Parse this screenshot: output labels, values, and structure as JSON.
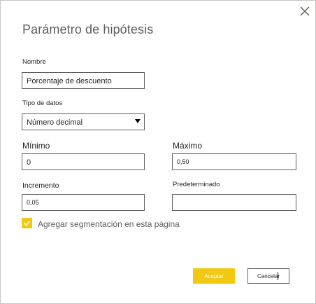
{
  "dialog": {
    "title": "Parámetro de hipótesis",
    "close_icon": "close-icon"
  },
  "fields": {
    "name_label": "Nombre",
    "name_value": "Porcentaje de descuento",
    "datatype_label": "Tipo de datos",
    "datatype_value": "Número decimal",
    "min_label": "Mínimo",
    "min_value": "0",
    "max_label": "Máximo",
    "max_value": "0,50",
    "increment_label": "Incremento",
    "increment_value": "0,05",
    "default_label": "Predeterminado",
    "default_value": ""
  },
  "options": {
    "add_slicer_label": "Agregar segmentación en esta página",
    "add_slicer_checked": true
  },
  "buttons": {
    "ok_label": "Aceptar",
    "cancel_label": "Cancelar"
  },
  "colors": {
    "accent": "#f2c811"
  }
}
